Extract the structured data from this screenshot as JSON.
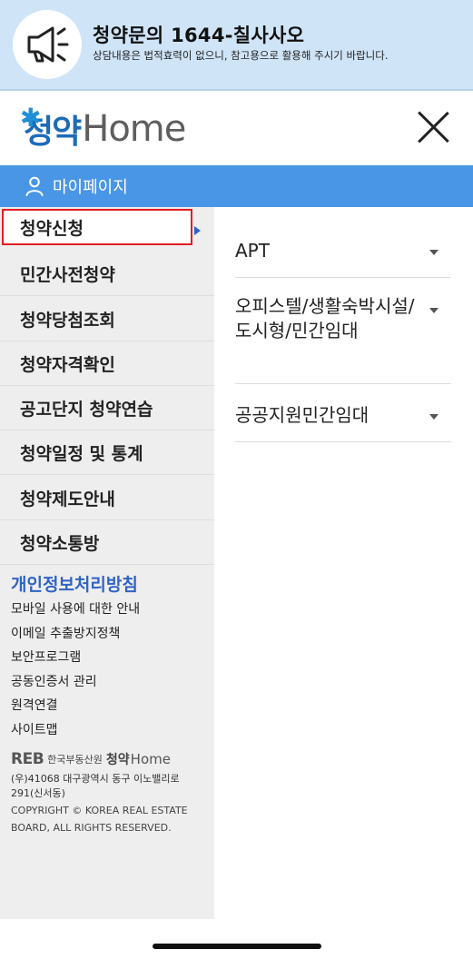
{
  "banner": {
    "icon": "megaphone-icon",
    "title": "청약문의 1644-칠사사오",
    "subtitle": "상담내용은 법적효력이 없으니, 참고용으로 활용해 주시기 바랍니다."
  },
  "logo": {
    "ko": "청약",
    "en": "Home"
  },
  "mypage": {
    "label": "마이페이지"
  },
  "nav": {
    "items": [
      {
        "label": "청약신청",
        "active": true
      },
      {
        "label": "민간사전청약"
      },
      {
        "label": "청약당첨조회"
      },
      {
        "label": "청약자격확인"
      },
      {
        "label": "공고단지 청약연습"
      },
      {
        "label": "청약일정 및 통계"
      },
      {
        "label": "청약제도안내"
      },
      {
        "label": "청약소통방"
      }
    ]
  },
  "submenu": {
    "items": [
      {
        "label": "APT"
      },
      {
        "label": "오피스텔/생활숙박시설/도시형/민간임대"
      },
      {
        "label": "공공지원민간임대"
      }
    ]
  },
  "footer": {
    "privacy": "개인정보처리방침",
    "links": [
      "모바일 사용에 대한 안내",
      "이메일 추출방지정책",
      "보안프로그램",
      "공동인증서 관리",
      "원격연결",
      "사이트맵"
    ],
    "reb_mark": "REB",
    "reb_org": "한국부동산원",
    "home_ko": "청약",
    "home_en": "Home",
    "address": "(우)41068 대구광역시 동구 이노밸리로 291(신서동)",
    "copyright": "COPYRIGHT © KOREA REAL ESTATE BOARD, ALL RIGHTS RESERVED."
  },
  "colors": {
    "accent": "#4a96e6",
    "banner_bg": "#cfe4f7",
    "active_border": "#e21d24",
    "link_blue": "#2f64c4"
  }
}
